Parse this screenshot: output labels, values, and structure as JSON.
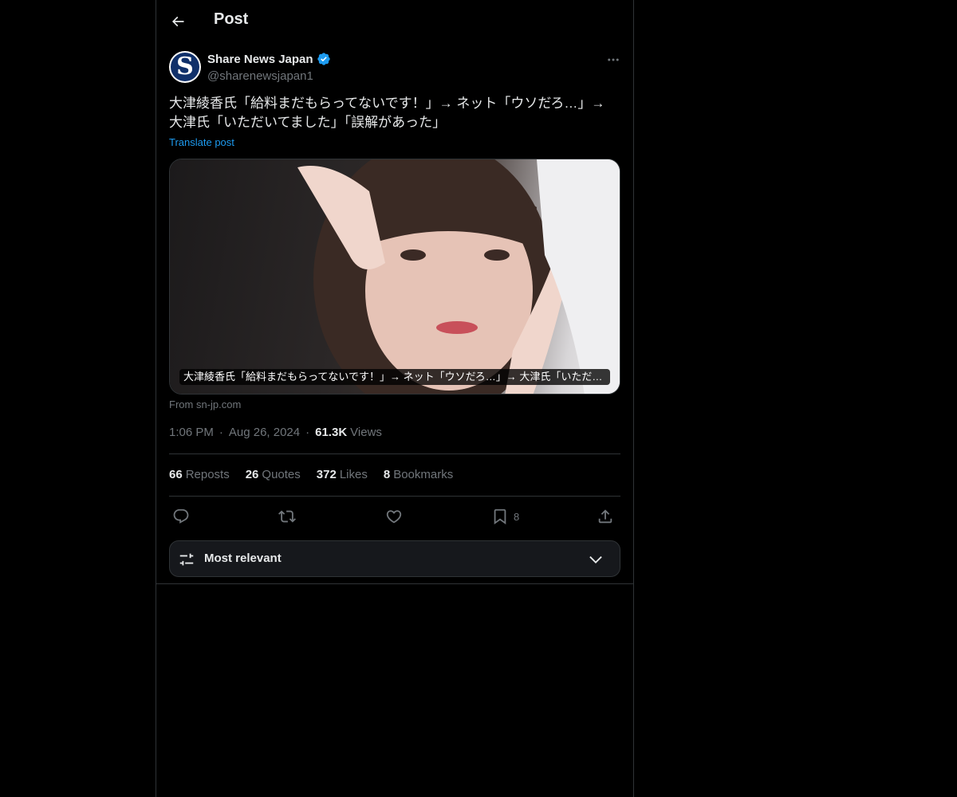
{
  "header": {
    "title": "Post",
    "back_icon": "arrow-left-icon"
  },
  "post": {
    "author": {
      "display_name": "Share News Japan",
      "handle": "@sharenewsjapan1",
      "avatar_letter": "S",
      "verified": true
    },
    "text_line1": "大津綾香氏「給料まだもらってないです！」→ ネット「ウソだろ…」→",
    "text_line2": "大津氏「いただいてました」「誤解があった」",
    "translate_label": "Translate post",
    "media": {
      "caption": "大津綾香氏「給料まだもらってないです！」→ ネット「ウソだろ…」→ 大津氏「いただいてました」「誤解があった」",
      "source": "From sn-jp.com"
    },
    "time": "1:06 PM",
    "date": "Aug 26, 2024",
    "views_count": "61.3K",
    "views_label": "Views"
  },
  "stats": {
    "reposts_count": "66",
    "reposts_label": "Reposts",
    "quotes_count": "26",
    "quotes_label": "Quotes",
    "likes_count": "372",
    "likes_label": "Likes",
    "bookmarks_count": "8",
    "bookmarks_label": "Bookmarks"
  },
  "actions": {
    "bookmark_count": "8"
  },
  "sort": {
    "label": "Most relevant"
  },
  "colors": {
    "background": "#000000",
    "text_primary": "#e7e9ea",
    "text_secondary": "#71767b",
    "link": "#1d9bf0",
    "verified": "#1d9bf0",
    "border": "#2f3336"
  }
}
